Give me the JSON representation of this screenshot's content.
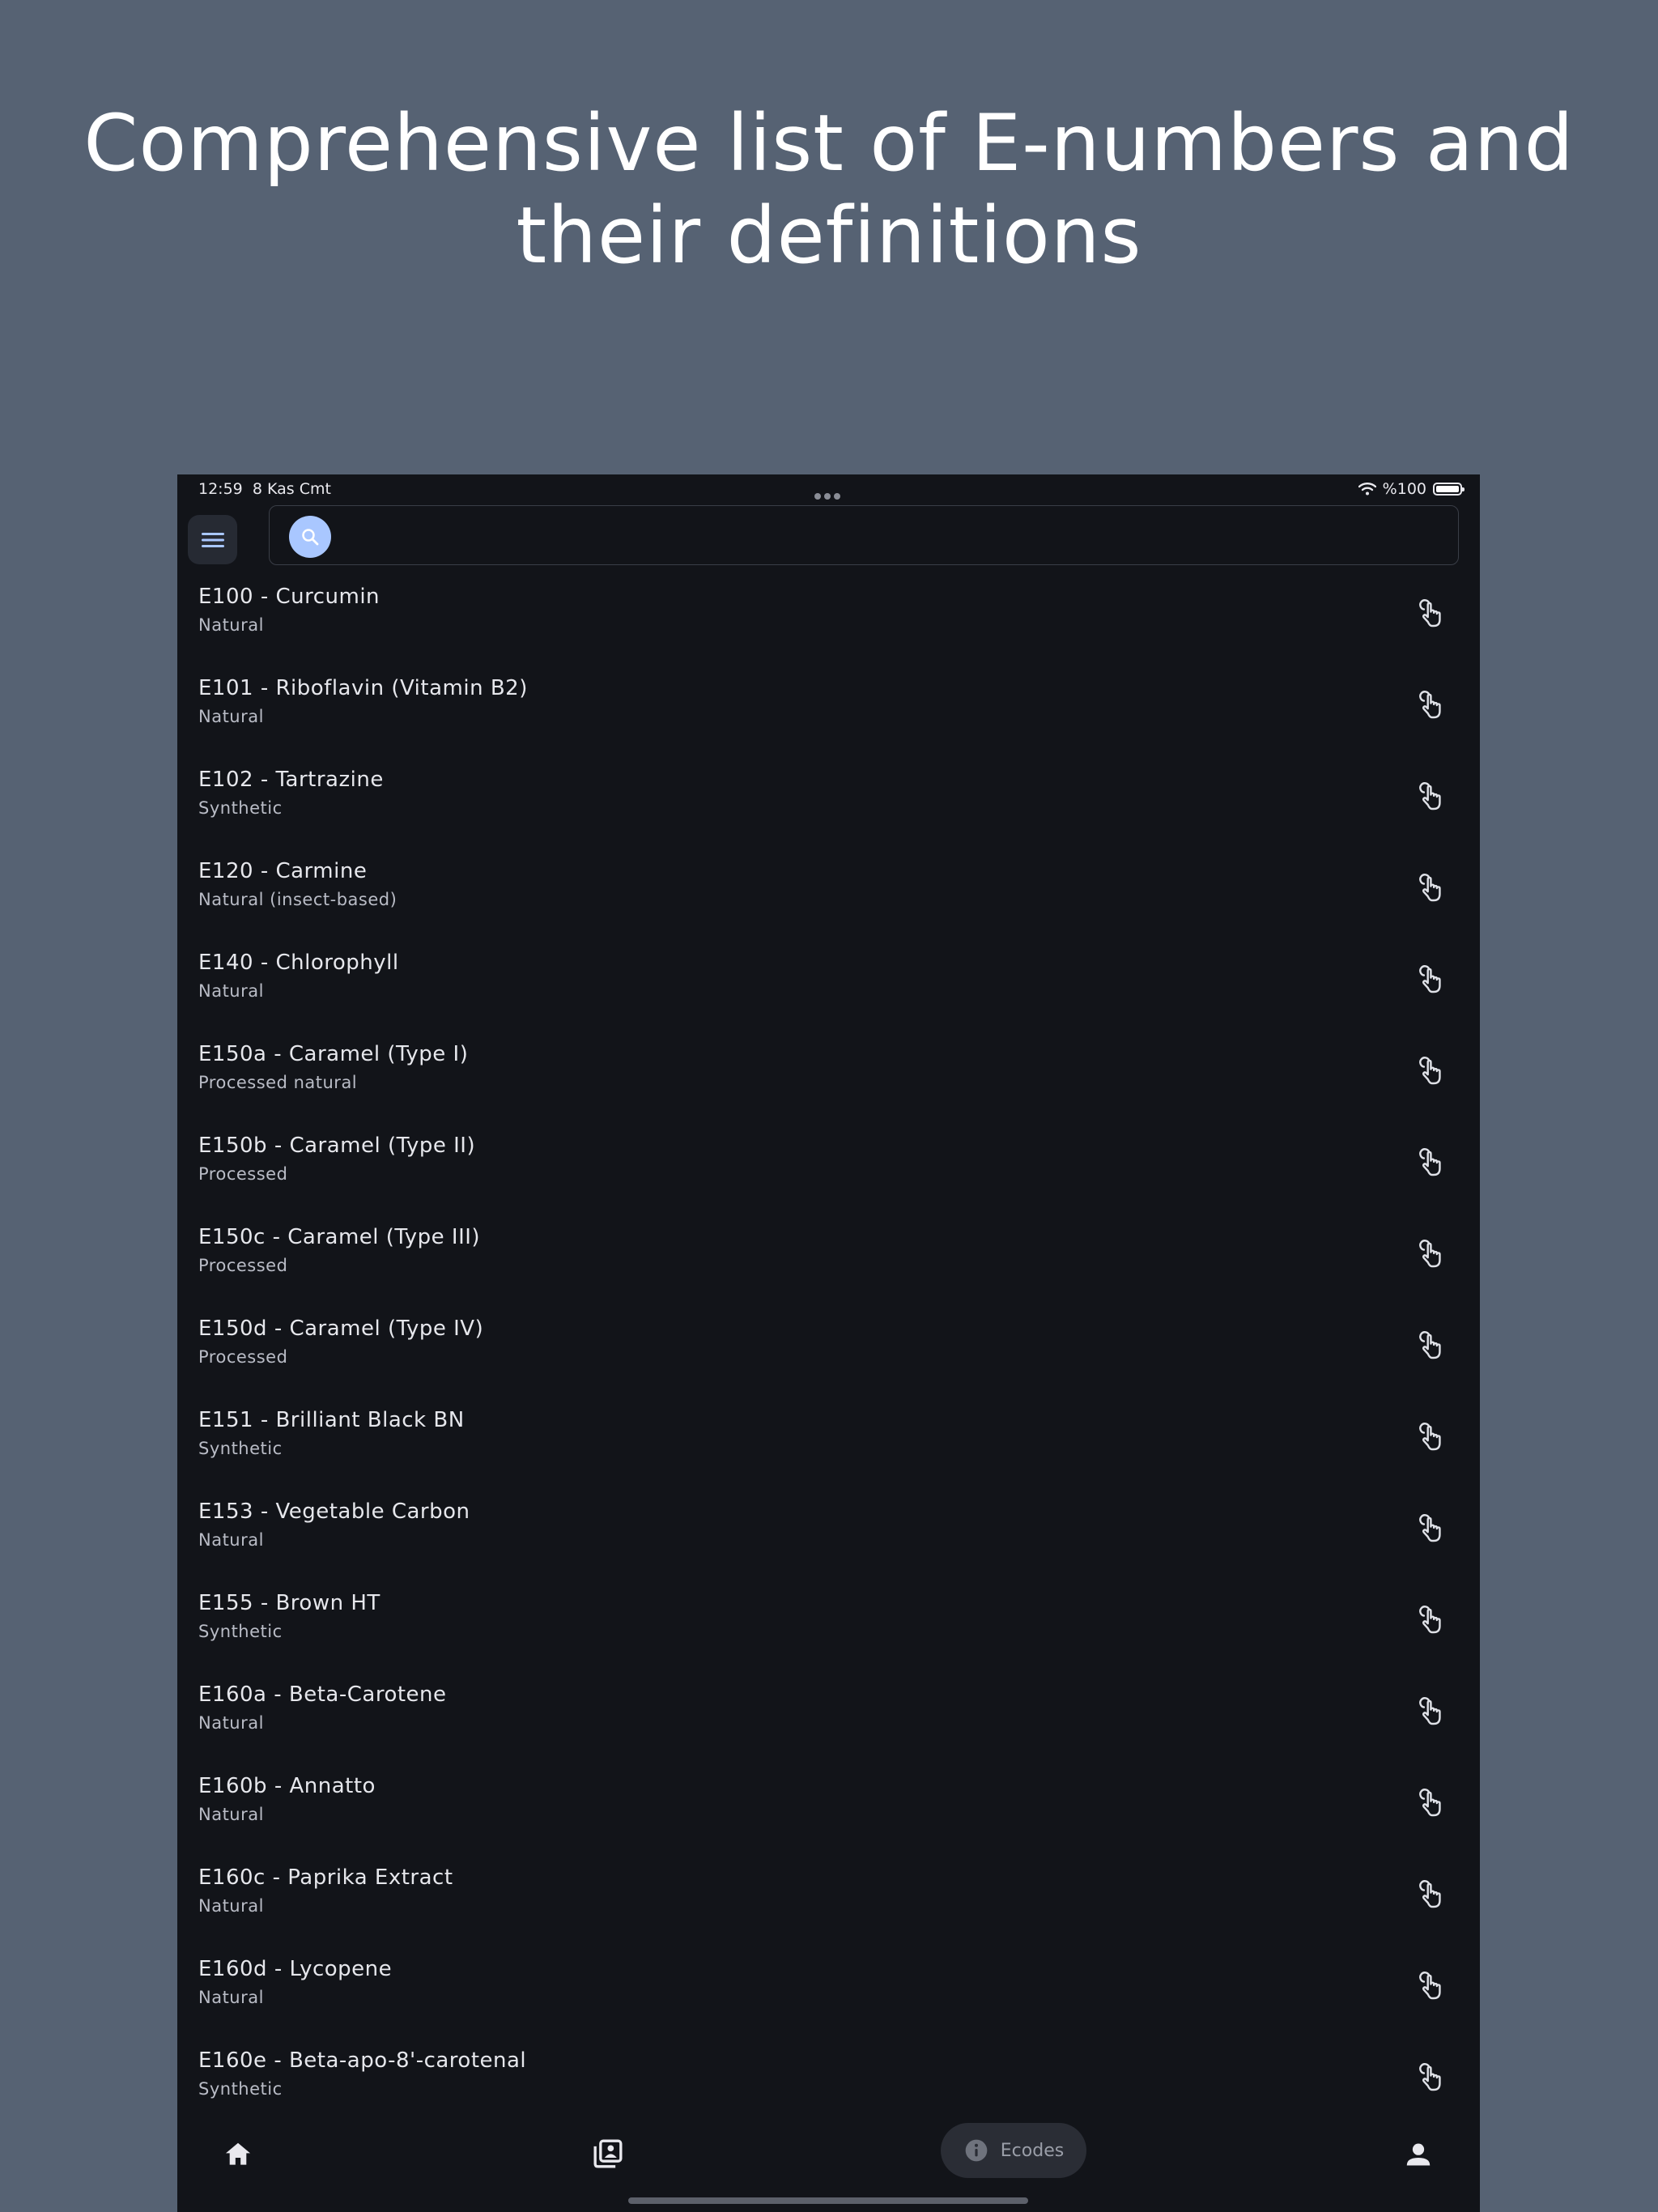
{
  "headline": "Comprehensive list of E-numbers and their definitions",
  "status": {
    "time": "12:59",
    "date": "8 Kas Cmt",
    "battery": "%100"
  },
  "search": {
    "value": "",
    "placeholder": ""
  },
  "items": [
    {
      "title": "E100 - Curcumin",
      "subtitle": "Natural"
    },
    {
      "title": "E101 - Riboflavin (Vitamin B2)",
      "subtitle": "Natural"
    },
    {
      "title": "E102 - Tartrazine",
      "subtitle": "Synthetic"
    },
    {
      "title": "E120 - Carmine",
      "subtitle": "Natural (insect-based)"
    },
    {
      "title": "E140 - Chlorophyll",
      "subtitle": "Natural"
    },
    {
      "title": "E150a - Caramel (Type I)",
      "subtitle": "Processed natural"
    },
    {
      "title": "E150b - Caramel (Type II)",
      "subtitle": "Processed"
    },
    {
      "title": "E150c - Caramel (Type III)",
      "subtitle": "Processed"
    },
    {
      "title": "E150d - Caramel (Type IV)",
      "subtitle": "Processed"
    },
    {
      "title": "E151 - Brilliant Black BN",
      "subtitle": "Synthetic"
    },
    {
      "title": "E153 - Vegetable Carbon",
      "subtitle": "Natural"
    },
    {
      "title": "E155 - Brown HT",
      "subtitle": "Synthetic"
    },
    {
      "title": "E160a - Beta-Carotene",
      "subtitle": "Natural"
    },
    {
      "title": "E160b - Annatto",
      "subtitle": "Natural"
    },
    {
      "title": "E160c - Paprika Extract",
      "subtitle": "Natural"
    },
    {
      "title": "E160d - Lycopene",
      "subtitle": "Natural"
    },
    {
      "title": "E160e - Beta-apo-8'-carotenal",
      "subtitle": "Synthetic"
    }
  ],
  "nav": {
    "ecodes_label": "Ecodes"
  },
  "icons": {
    "menu": "hamburger-icon",
    "search": "search-icon",
    "row_action": "tap-icon",
    "home": "home-icon",
    "library": "library-icon",
    "info": "info-icon",
    "profile": "person-icon"
  },
  "colors": {
    "background": "#566273",
    "device": "#121419",
    "accent": "#a9c7ff"
  }
}
